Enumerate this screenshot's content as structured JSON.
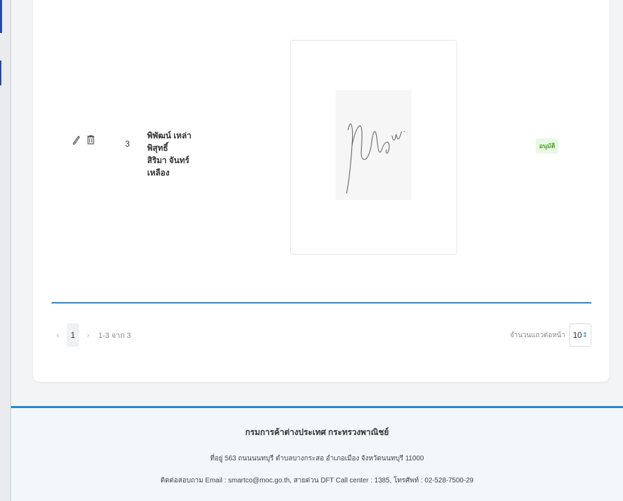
{
  "table": {
    "row": {
      "number": "3",
      "name_line1": "พิพัฒน์ เหล่าพิสุทธิ์",
      "name_line2": "สิริมา จันทร์เหลือง",
      "status": "อนุมัติ"
    }
  },
  "pagination": {
    "prev_label": "‹",
    "current_page": "1",
    "next_label": "›",
    "range_text": "1-3 จาก 3",
    "per_page_label": "จำนวนแถวต่อหน้า",
    "per_page_value": "10"
  },
  "footer": {
    "title": "กรมการค้าต่างประเทศ กระทรวงพาณิชย์",
    "address": "ที่อยู่ 563 ถนนนนทบุรี ตำบลบางกระสอ อำเภอเมือง จังหวัดนนทบุรี 11000",
    "contact": "ติดต่อสอบถาม Email : smartco@moc.go.th, สายด่วน DFT Call center : 1385, โทรศัพท์ : 02-528-7500-29"
  },
  "colors": {
    "accent": "#2a86c9",
    "status_bg": "#e9f8e6",
    "status_text": "#52a52a"
  }
}
